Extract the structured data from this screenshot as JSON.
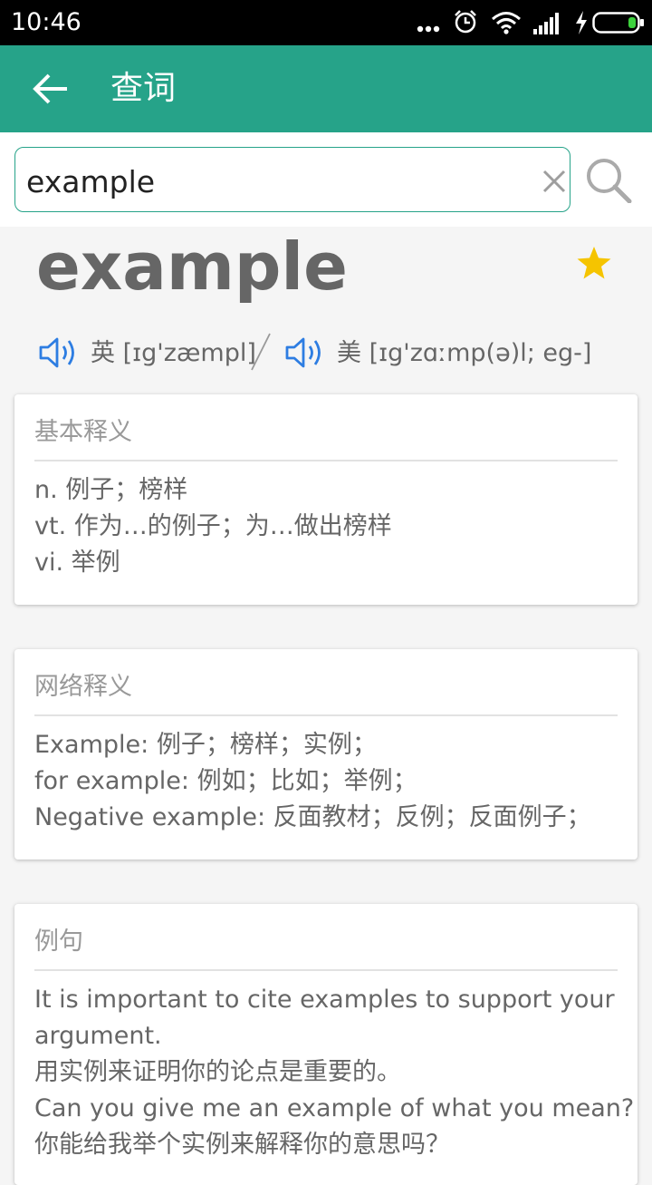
{
  "status_bar": {
    "time": "10:46",
    "icons": [
      "more-dots-icon",
      "alarm-icon",
      "wifi-icon",
      "signal-icon",
      "charging-bolt-icon",
      "battery-icon"
    ],
    "battery_color": "#3dd13d"
  },
  "toolbar": {
    "title": "查词",
    "color": "#26a389"
  },
  "search": {
    "value": "example"
  },
  "word": {
    "headword": "example",
    "favorite_color": "#f5c400",
    "uk_label": "英 [ɪg'zæmpl]",
    "us_label": "美 [ɪg'zɑːmp(ə)l; eg-]",
    "speaker_color": "#2d7de2"
  },
  "cards": {
    "basic": {
      "title": "基本释义",
      "lines": [
        "n. 例子；榜样",
        "vt. 作为…的例子；为…做出榜样",
        "vi. 举例"
      ]
    },
    "web": {
      "title": "网络释义",
      "lines": [
        "Example:  例子；榜样；实例；",
        "for example:  例如；比如；举例；",
        "Negative example:  反面教材；反例；反面例子；"
      ]
    },
    "examples": {
      "title": "例句",
      "lines": [
        "It is important to cite examples to support your",
        "argument.",
        "用实例来证明你的论点是重要的。",
        "Can you give me an example of what you mean?",
        "你能给我举个实例来解释你的意思吗？"
      ]
    }
  }
}
